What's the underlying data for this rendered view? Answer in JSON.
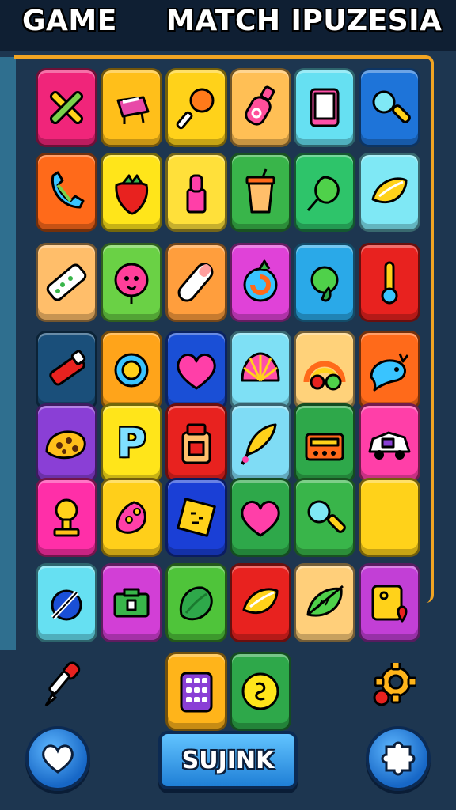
{
  "header": {
    "title_left": "GAME",
    "title_right": "MATCH IPUZESIA"
  },
  "action_button": {
    "label": "SUJINK"
  },
  "colors": {
    "frame_accent": "#f0a423",
    "background": "#1d3650",
    "button_blue": "#1f7fd6"
  },
  "board": {
    "rows": [
      [
        {
          "color": "#f0257a",
          "icon": "crossed-tools-icon"
        },
        {
          "color": "#ffbf1a",
          "icon": "teapot-icon"
        },
        {
          "color": "#ffd21a",
          "icon": "lollipop-icon"
        },
        {
          "color": "#ffbf55",
          "icon": "potion-bottle-icon"
        },
        {
          "color": "#66e0f2",
          "icon": "tablet-icon"
        },
        {
          "color": "#1e74d9",
          "icon": "magnifier-icon"
        }
      ],
      [
        {
          "color": "#ff6a1a",
          "icon": "phone-handset-icon"
        },
        {
          "color": "#ffe51a",
          "icon": "strawberry-icon"
        },
        {
          "color": "#ffe03a",
          "icon": "lipstick-icon"
        },
        {
          "color": "#39b54a",
          "icon": "cup-icon"
        },
        {
          "color": "#2ec46a",
          "icon": "leaf-branch-icon"
        },
        {
          "color": "#7fe8f5",
          "icon": "lemon-icon"
        }
      ],
      [
        {
          "color": "#ffbe6a",
          "icon": "ticket-icon"
        },
        {
          "color": "#6ad145",
          "icon": "flower-face-icon"
        },
        {
          "color": "#ff9e3d",
          "icon": "capsule-icon"
        },
        {
          "color": "#e042d8",
          "icon": "swirl-fruit-icon"
        },
        {
          "color": "#2aa9e8",
          "icon": "apple-icon"
        },
        {
          "color": "#e8221f",
          "icon": "thermometer-icon"
        }
      ],
      [
        {
          "color": "#1a4f7a",
          "icon": "battery-icon"
        },
        {
          "color": "#ffa41a",
          "icon": "lemon-slice-icon"
        },
        {
          "color": "#1a4fd6",
          "icon": "heart-icon"
        },
        {
          "color": "#7ee0f5",
          "icon": "seashell-icon"
        },
        {
          "color": "#ffd27a",
          "icon": "rainbow-icon"
        },
        {
          "color": "#ff6a1a",
          "icon": "bird-icon"
        }
      ],
      [
        {
          "color": "#8a3fd6",
          "icon": "cookie-icon"
        },
        {
          "color": "#ffe51a",
          "icon": "letter-p-icon",
          "glyph": "P"
        },
        {
          "color": "#e8221f",
          "icon": "jar-icon"
        },
        {
          "color": "#7fdcf5",
          "icon": "feather-icon"
        },
        {
          "color": "#2ea84a",
          "icon": "radio-icon"
        },
        {
          "color": "#ff3fa8",
          "icon": "car-icon"
        }
      ],
      [
        {
          "color": "#ff2fa8",
          "icon": "stamp-icon"
        },
        {
          "color": "#ffcf1a",
          "icon": "candy-icon"
        },
        {
          "color": "#1a3fd6",
          "icon": "puzzle-piece-icon"
        },
        {
          "color": "#2ea84a",
          "icon": "heart-icon"
        },
        {
          "color": "#39b54a",
          "icon": "magnifier-icon"
        },
        {
          "color": "#ffd21a",
          "icon": "lightbulb-icon"
        }
      ],
      [
        {
          "color": "#66e0f2",
          "icon": "compass-icon"
        },
        {
          "color": "#d23fd6",
          "icon": "camera-icon"
        },
        {
          "color": "#4fc43a",
          "icon": "lettuce-icon"
        },
        {
          "color": "#e8221f",
          "icon": "lemon-icon"
        },
        {
          "color": "#ffcf7a",
          "icon": "leaf-icon"
        },
        {
          "color": "#c23fd6",
          "icon": "map-pin-icon"
        }
      ]
    ],
    "extra": [
      {
        "color": "#ffb41a",
        "icon": "calculator-icon"
      },
      {
        "color": "#2ea84a",
        "icon": "coin-icon"
      }
    ]
  },
  "controls": {
    "left_icon": "dropper-icon",
    "right_icon": "gear-icon",
    "favorite_icon": "heart-icon",
    "settings_icon": "puzzle-icon"
  }
}
